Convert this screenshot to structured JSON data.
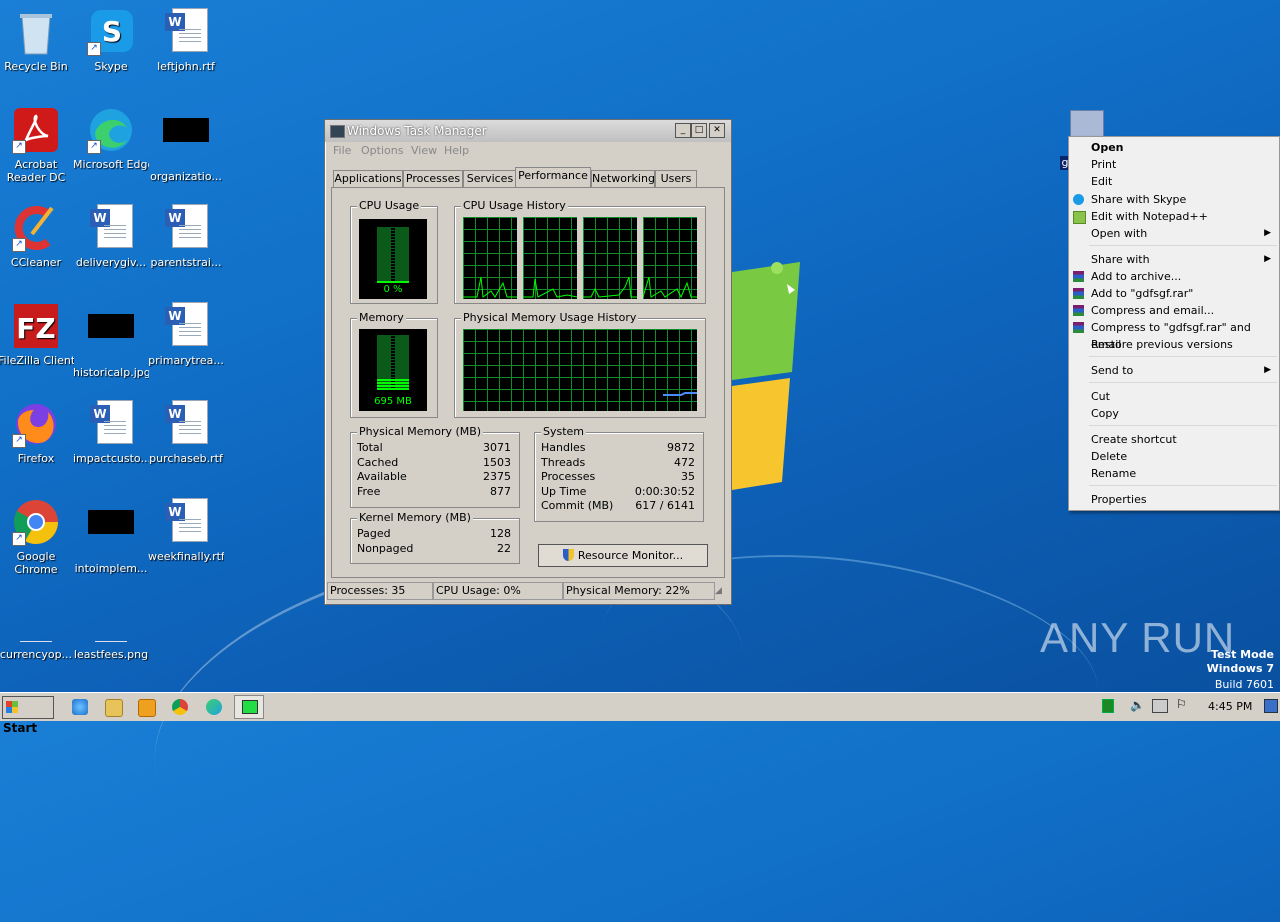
{
  "desktop": {
    "icons": [
      {
        "label": "Recycle Bin"
      },
      {
        "label": "Skype"
      },
      {
        "label": "leftjohn.rtf"
      },
      {
        "label": "Acrobat Reader DC"
      },
      {
        "label": "Microsoft Edge"
      },
      {
        "label": "organizatio..."
      },
      {
        "label": "CCleaner"
      },
      {
        "label": "deliverygiv..."
      },
      {
        "label": "parentstrai..."
      },
      {
        "label": "FileZilla Client"
      },
      {
        "label": "historicalp.jpg"
      },
      {
        "label": "primarytrea..."
      },
      {
        "label": "Firefox"
      },
      {
        "label": "impactcusto..."
      },
      {
        "label": "purchaseb.rtf"
      },
      {
        "label": "Google Chrome"
      },
      {
        "label": "intoimplem..."
      },
      {
        "label": "weekfinally.rtf"
      },
      {
        "label": "currencyop..."
      },
      {
        "label": "leastfees.png"
      }
    ],
    "selected_file_label": "g"
  },
  "task_manager": {
    "title": "Windows Task Manager",
    "menu": [
      "File",
      "Options",
      "View",
      "Help"
    ],
    "tabs": [
      "Applications",
      "Processes",
      "Services",
      "Performance",
      "Networking",
      "Users"
    ],
    "active_tab": "Performance",
    "cpu_usage": {
      "title": "CPU Usage",
      "value": "0 %"
    },
    "cpu_history": {
      "title": "CPU Usage History"
    },
    "memory": {
      "title": "Memory",
      "value": "695 MB"
    },
    "mem_history": {
      "title": "Physical Memory Usage History"
    },
    "physical_memory": {
      "title": "Physical Memory (MB)",
      "rows": [
        {
          "label": "Total",
          "value": "3071"
        },
        {
          "label": "Cached",
          "value": "1503"
        },
        {
          "label": "Available",
          "value": "2375"
        },
        {
          "label": "Free",
          "value": "877"
        }
      ]
    },
    "kernel_memory": {
      "title": "Kernel Memory (MB)",
      "rows": [
        {
          "label": "Paged",
          "value": "128"
        },
        {
          "label": "Nonpaged",
          "value": "22"
        }
      ]
    },
    "system": {
      "title": "System",
      "rows": [
        {
          "label": "Handles",
          "value": "9872"
        },
        {
          "label": "Threads",
          "value": "472"
        },
        {
          "label": "Processes",
          "value": "35"
        },
        {
          "label": "Up Time",
          "value": "0:00:30:52"
        },
        {
          "label": "Commit (MB)",
          "value": "617 / 6141"
        }
      ]
    },
    "resource_monitor_button": "Resource Monitor...",
    "status": {
      "processes": "Processes: 35",
      "cpu": "CPU Usage: 0%",
      "memory": "Physical Memory: 22%"
    }
  },
  "context_menu": {
    "items": [
      {
        "label": "Open",
        "bold": true
      },
      {
        "label": "Print"
      },
      {
        "label": "Edit"
      },
      {
        "label": "Share with Skype",
        "icon": "skype-icon"
      },
      {
        "label": "Edit with Notepad++",
        "icon": "notepad-plus-icon"
      },
      {
        "label": "Open with",
        "submenu": true
      },
      {
        "label": "Share with",
        "submenu": true
      },
      {
        "label": "Add to archive...",
        "icon": "winrar-icon"
      },
      {
        "label": "Add to \"gdfsgf.rar\"",
        "icon": "winrar-icon"
      },
      {
        "label": "Compress and email...",
        "icon": "winrar-icon"
      },
      {
        "label": "Compress to \"gdfsgf.rar\" and email",
        "icon": "winrar-icon"
      },
      {
        "label": "Restore previous versions"
      },
      {
        "label": "Send to",
        "submenu": true
      },
      {
        "label": "Cut"
      },
      {
        "label": "Copy"
      },
      {
        "label": "Create shortcut"
      },
      {
        "label": "Delete"
      },
      {
        "label": "Rename"
      },
      {
        "label": "Properties"
      }
    ]
  },
  "taskbar": {
    "start_label": "Start",
    "clock": "4:45 PM"
  },
  "watermark": {
    "brand": "ANY RUN",
    "line1": "Test Mode",
    "line2": "Windows 7",
    "line3": "Build 7601"
  },
  "colors": {
    "graph_green": "#00ff00",
    "grid_green": "#138a2b",
    "desktop_blue": "#1170c8"
  }
}
